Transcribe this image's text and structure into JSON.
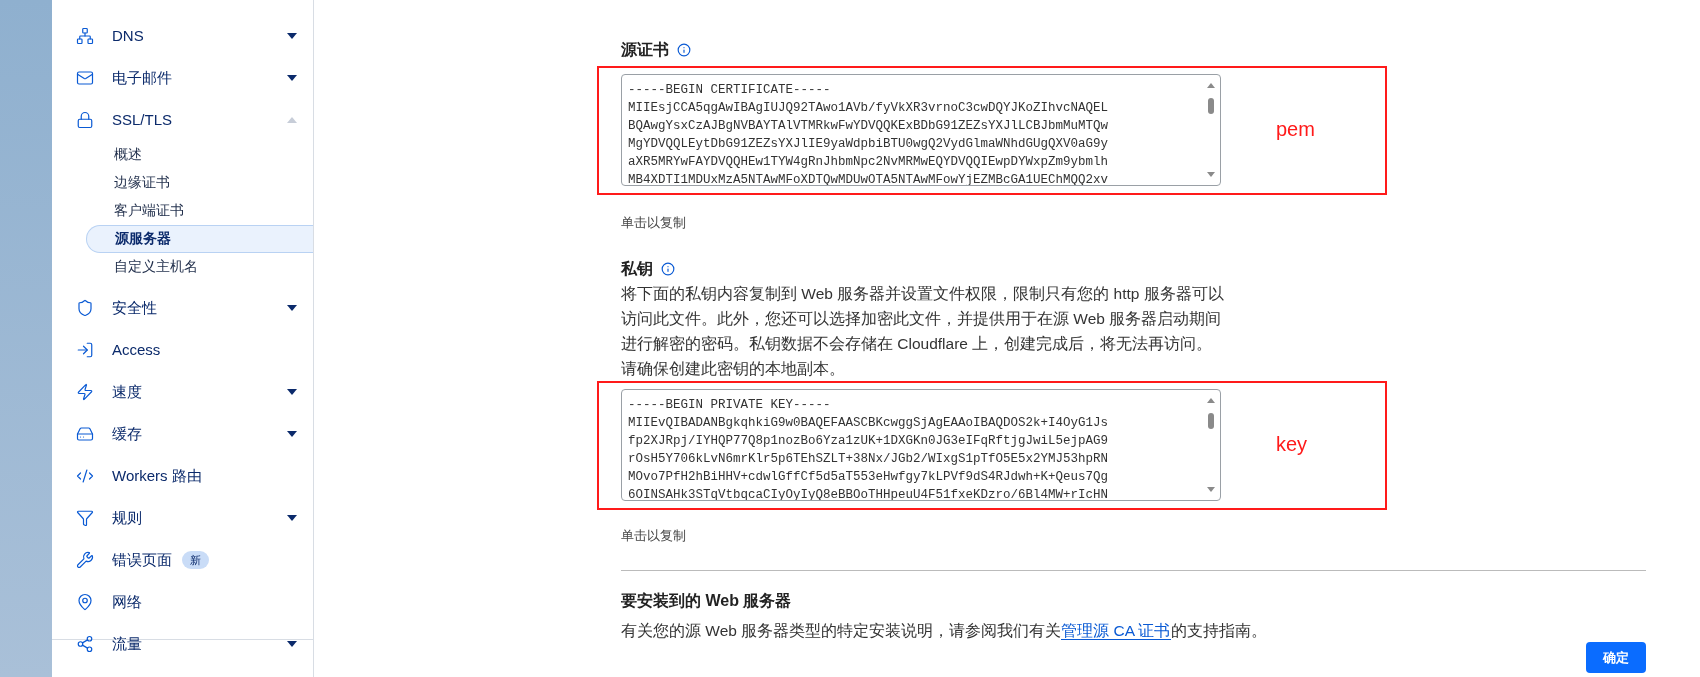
{
  "sidebar": {
    "items": [
      {
        "label": "DNS",
        "expanded": false
      },
      {
        "label": "电子邮件",
        "expanded": false
      },
      {
        "label": "SSL/TLS",
        "expanded": true,
        "children": [
          {
            "label": "概述",
            "selected": false
          },
          {
            "label": "边缘证书",
            "selected": false
          },
          {
            "label": "客户端证书",
            "selected": false
          },
          {
            "label": "源服务器",
            "selected": true
          },
          {
            "label": "自定义主机名",
            "selected": false
          }
        ]
      },
      {
        "label": "安全性",
        "expanded": false
      },
      {
        "label": "Access"
      },
      {
        "label": "速度",
        "expanded": false
      },
      {
        "label": "缓存",
        "expanded": false
      },
      {
        "label": "Workers 路由"
      },
      {
        "label": "规则",
        "expanded": false
      },
      {
        "label": "错误页面",
        "badge": "新"
      },
      {
        "label": "网络"
      },
      {
        "label": "流量",
        "expanded": false
      }
    ]
  },
  "certificate": {
    "title": "源证书",
    "annotation": "pem",
    "lines": [
      "-----BEGIN CERTIFICATE-----",
      "MIIEsjCCA5qgAwIBAgIUJQ92TAwo1AVb/fyVkXR3vrnoC3cwDQYJKoZIhvcNAQEL",
      "BQAwgYsxCzAJBgNVBAYTAlVTMRkwFwYDVQQKExBDbG91ZEZsYXJlLCBJbmMuMTQw",
      "MgYDVQQLEytDbG91ZEZsYXJlIE9yaWdpbiBTU0wgQ2VydGlmaWNhdGUgQXV0aG9y",
      "aXR5MRYwFAYDVQQHEw1TYW4gRnJhbmNpc2NvMRMwEQYDVQQIEwpDYWxpZm9ybmlh",
      "MB4XDTI1MDUxMzA5NTAwMFoXDTQwMDUwOTA5NTAwMFowYjEZMBcGA1UEChMQQ2xv"
    ],
    "hint": "单击以复制"
  },
  "private_key": {
    "title": "私钥",
    "description": "将下面的私钥内容复制到 Web 服务器并设置文件权限，限制只有您的 http 服务器可以访问此文件。此外，您还可以选择加密此文件，并提供用于在源 Web 服务器启动期间进行解密的密码。私钥数据不会存储在 Cloudflare 上，创建完成后，将无法再访问。请确保创建此密钥的本地副本。",
    "annotation": "key",
    "lines": [
      "-----BEGIN PRIVATE KEY-----",
      "MIIEvQIBADANBgkqhkiG9w0BAQEFAASCBKcwggSjAgEAAoIBAQDOS2k+I4OyG1Js",
      "fp2XJRpj/IYHQP77Q8p1nozBo6Yza1zUK+1DXGKn0JG3eIFqRftjgJwiL5ejpAG9",
      "rOsH5Y706kLvN6mrKlr5p6TEhSZLT+38Nx/JGb2/WIxgS1pTfO5E5x2YMJ53hpRN",
      "MOvo7PfH2hBiHHV+cdwlGffCf5d5aT553eHwfgy7kLPVf9dS4RJdwh+K+Qeus7Qg",
      "6OINSAHk3STqVtbqcaCIyOyIyQ8eBBOoTHHpeuU4F51fxeKDzro/6Bl4MW+rIcHN"
    ],
    "hint": "单击以复制"
  },
  "install": {
    "title": "要安装到的 Web 服务器",
    "text_before": "有关您的源 Web 服务器类型的特定安装说明，请参阅我们有关",
    "link": "管理源 CA 证书",
    "text_after": "的支持指南。"
  },
  "confirm_button": "确定"
}
